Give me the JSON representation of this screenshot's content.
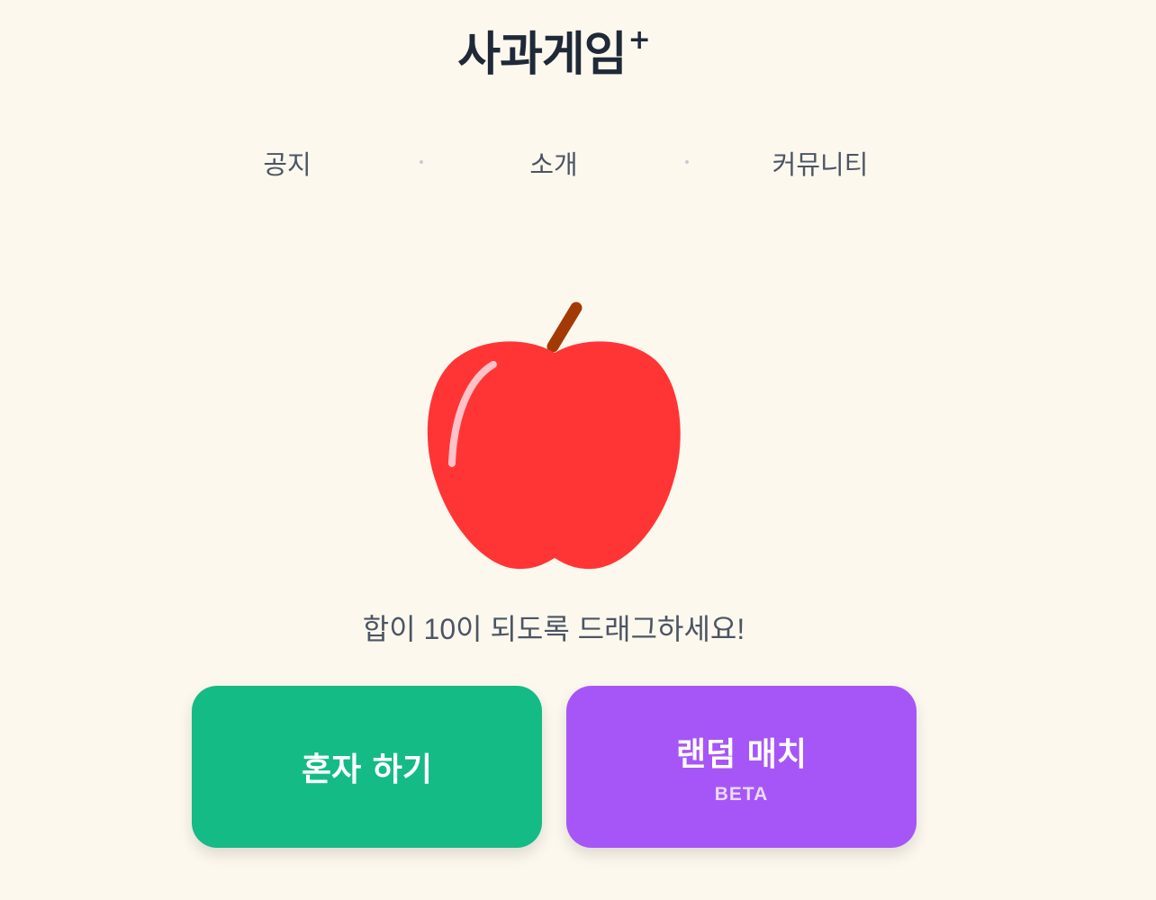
{
  "header": {
    "title": "사과게임",
    "title_suffix": "+"
  },
  "nav": {
    "items": [
      {
        "label": "공지"
      },
      {
        "label": "소개"
      },
      {
        "label": "커뮤니티"
      }
    ]
  },
  "hero": {
    "image_icon": "apple-icon",
    "instruction": "합이 10이 되도록 드래그하세요!"
  },
  "actions": {
    "solo": {
      "label": "혼자 하기"
    },
    "random_match": {
      "label": "랜덤 매치",
      "badge": "BETA"
    }
  },
  "colors": {
    "background": "#fdf8ee",
    "solo_button": "#15bb84",
    "match_button": "#a656f7",
    "apple": "#ff3535",
    "stem": "#a33a06"
  }
}
